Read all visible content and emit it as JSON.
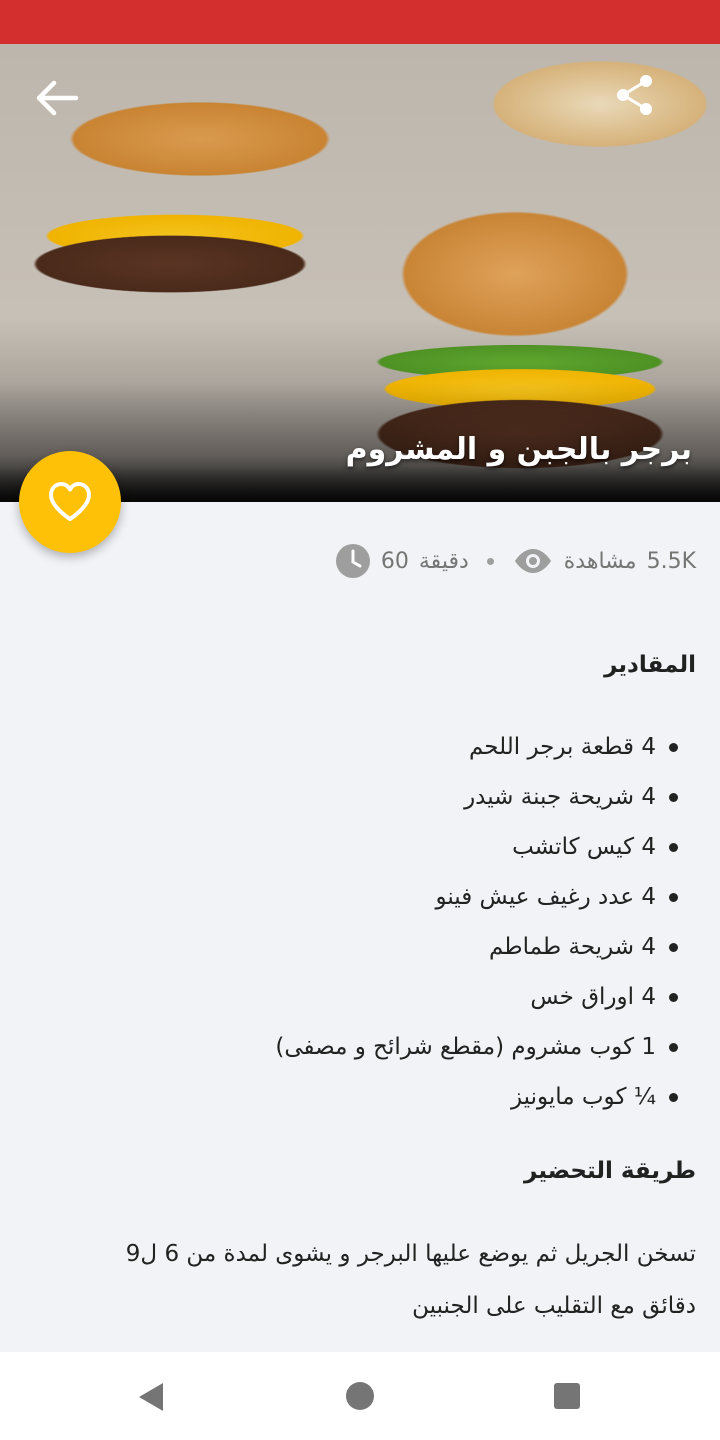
{
  "header": {
    "title": "برجر بالجبن و المشروم",
    "back_icon": "arrow-back-icon",
    "share_icon": "share-icon"
  },
  "favorite": {
    "icon": "heart-outline-icon",
    "color": "#ffc107"
  },
  "meta": {
    "time_value": "60",
    "time_unit": "دقيقة",
    "views_value": "5.5K",
    "views_label": "مشاهدة"
  },
  "ingredients": {
    "title": "المقادير",
    "items": [
      "4  قطعة برجر اللحم",
      "4  شريحة جبنة شيدر",
      "4  كيس كاتشب",
      "4  عدد رغيف عيش فينو",
      "4  شريحة طماطم",
      "4  اوراق خس",
      "1  كوب مشروم (مقطع شرائح و مصفى)",
      "¼  كوب مايونيز"
    ]
  },
  "preparation": {
    "title": "طريقة التحضير",
    "text": "تسخن الجريل ثم يوضع عليها البرجر و يشوى لمدة من 6 ل9 دقائق مع التقليب على الجنبين"
  },
  "colors": {
    "status_bar": "#d32f2f",
    "background": "#f2f3f7",
    "accent": "#ffc107"
  }
}
